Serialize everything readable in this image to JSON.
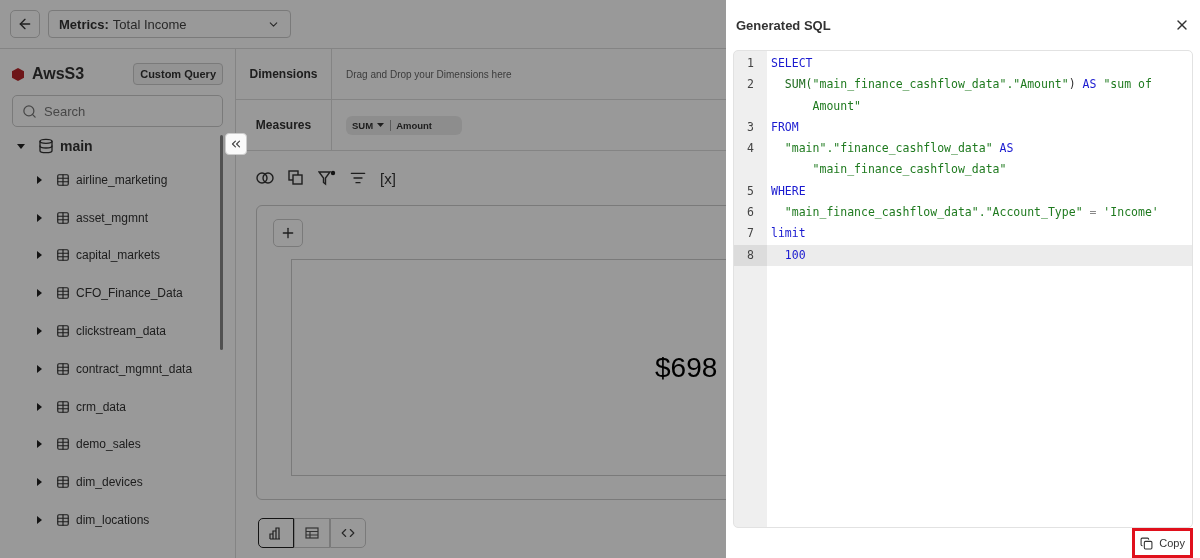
{
  "top_bar": {
    "metric_label": "Metrics:",
    "metric_value": "Total Income"
  },
  "sidebar": {
    "source": "AwsS3",
    "custom_query_button": "Custom Query",
    "search": {
      "placeholder": "Search"
    },
    "tree": [
      {
        "label": "main",
        "expanded": true,
        "children": [
          {
            "label": "airline_marketing",
            "expanded": false
          },
          {
            "label": "asset_mgmnt",
            "expanded": false
          },
          {
            "label": "capital_markets",
            "expanded": false
          },
          {
            "label": "CFO_Finance_Data",
            "expanded": false
          },
          {
            "label": "clickstream_data",
            "expanded": false
          },
          {
            "label": "contract_mgmnt_data",
            "expanded": false
          },
          {
            "label": "crm_data",
            "expanded": false
          },
          {
            "label": "demo_sales",
            "expanded": false
          },
          {
            "label": "dim_devices",
            "expanded": false
          },
          {
            "label": "dim_locations",
            "expanded": false
          }
        ]
      }
    ]
  },
  "query": {
    "rows": [
      {
        "label": "Dimensions",
        "kind": "placeholder",
        "placeholder": "Drag and Drop your Dimensions here"
      },
      {
        "label": "Measures",
        "kind": "chips",
        "chips": [
          {
            "aggregate": "SUM",
            "field": "Amount"
          }
        ]
      }
    ]
  },
  "toolbar": [
    {
      "kind": "join"
    },
    {
      "kind": "duplicate"
    },
    {
      "kind": "filter"
    },
    {
      "kind": "sort"
    },
    {
      "kind": "variable",
      "text": "[x]"
    }
  ],
  "result": {
    "value": "$698"
  },
  "view_tabs": [
    {
      "kind": "chart",
      "selected": true
    },
    {
      "kind": "table",
      "selected": false
    },
    {
      "kind": "code",
      "selected": false
    }
  ],
  "drawer": {
    "title": "Generated SQL",
    "lines": [
      {
        "number": "1",
        "selected": false,
        "rows": [
          {
            "tokens": [
              {
                "kind": "keyword",
                "text": "SELECT"
              }
            ]
          }
        ]
      },
      {
        "number": "2",
        "selected": false,
        "rows": [
          {
            "tokens": [
              {
                "kind": "function",
                "text": "  SUM("
              },
              {
                "kind": "string",
                "text": "\"main_finance_cashflow_data\".\"Amount\""
              },
              {
                "kind": "plain",
                "text": ") "
              },
              {
                "kind": "keyword",
                "text": "AS"
              },
              {
                "kind": "string",
                "text": " \"sum of"
              }
            ]
          },
          {
            "tokens": [
              {
                "kind": "string",
                "text": "      Amount\""
              }
            ]
          }
        ]
      },
      {
        "number": "3",
        "selected": false,
        "rows": [
          {
            "tokens": [
              {
                "kind": "keyword",
                "text": "FROM"
              }
            ]
          }
        ]
      },
      {
        "number": "4",
        "selected": false,
        "rows": [
          {
            "tokens": [
              {
                "kind": "string",
                "text": "  \"main\".\"finance_cashflow_data\" "
              },
              {
                "kind": "keyword",
                "text": "AS"
              }
            ]
          },
          {
            "tokens": [
              {
                "kind": "string",
                "text": "      \"main_finance_cashflow_data\""
              }
            ]
          }
        ]
      },
      {
        "number": "5",
        "selected": false,
        "rows": [
          {
            "tokens": [
              {
                "kind": "keyword",
                "text": "WHERE"
              }
            ]
          }
        ]
      },
      {
        "number": "6",
        "selected": false,
        "rows": [
          {
            "tokens": [
              {
                "kind": "string",
                "text": "  \"main_finance_cashflow_data\".\"Account_Type\" "
              },
              {
                "kind": "operator",
                "text": "= "
              },
              {
                "kind": "string",
                "text": "'Income'"
              }
            ]
          }
        ]
      },
      {
        "number": "7",
        "selected": false,
        "rows": [
          {
            "tokens": [
              {
                "kind": "keyword",
                "text": "limit"
              }
            ]
          }
        ]
      },
      {
        "number": "8",
        "selected": true,
        "rows": [
          {
            "tokens": [
              {
                "kind": "number",
                "text": "  100"
              }
            ]
          }
        ]
      }
    ],
    "copy_button": {
      "label": "Copy",
      "highlighted": true
    }
  }
}
